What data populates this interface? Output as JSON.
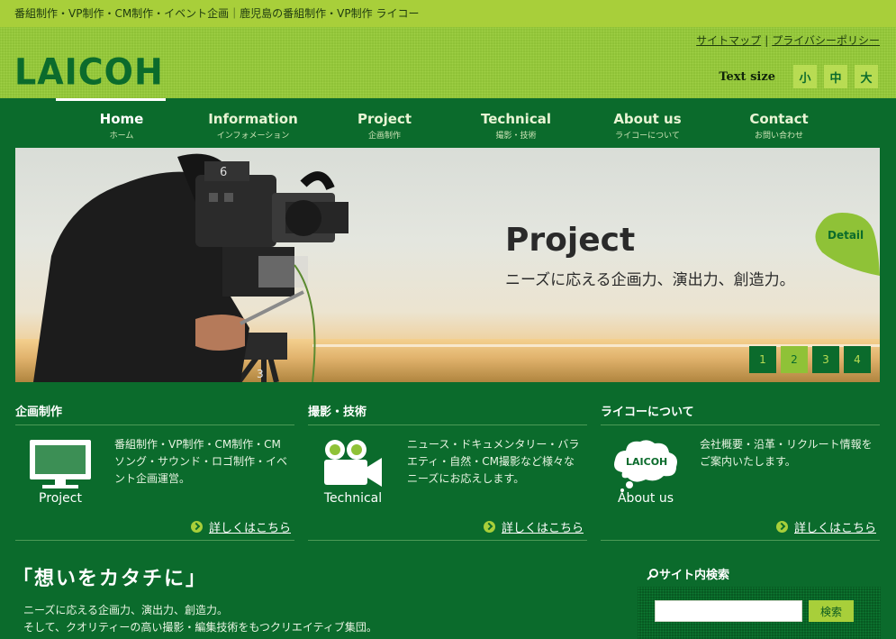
{
  "tagline": "番組制作・VP制作・CM制作・イベント企画｜鹿児島の番組制作・VP制作 ライコー",
  "header": {
    "logo": "LAICOH",
    "util_links": [
      "サイトマップ",
      "プライバシーポリシー"
    ],
    "util_separator": "|",
    "text_size_label": "Text size",
    "text_size_options": [
      "小",
      "中",
      "大"
    ]
  },
  "nav": [
    {
      "en": "Home",
      "ja": "ホーム",
      "active": true
    },
    {
      "en": "Information",
      "ja": "インフォメーション"
    },
    {
      "en": "Project",
      "ja": "企画制作"
    },
    {
      "en": "Technical",
      "ja": "撮影・技術"
    },
    {
      "en": "About us",
      "ja": "ライコーについて"
    },
    {
      "en": "Contact",
      "ja": "お問い合わせ"
    }
  ],
  "hero": {
    "title": "Project",
    "subtitle": "ニーズに応える企画力、演出力、創造力。",
    "detail": "Detail",
    "pages": [
      "1",
      "2",
      "3",
      "4"
    ],
    "current_page": "2"
  },
  "features": [
    {
      "title": "企画制作",
      "icon": "monitor-icon",
      "caption": "Project",
      "desc": "番組制作・VP制作・CM制作・CMソング・サウンド・ロゴ制作・イベント企画運営。",
      "more": "詳しくはこちら"
    },
    {
      "title": "撮影・技術",
      "icon": "video-camera-icon",
      "caption": "Technical",
      "desc": "ニュース・ドキュメンタリー・バラエティ・自然・CM撮影など様々なニーズにお応えします。",
      "more": "詳しくはこちら"
    },
    {
      "title": "ライコーについて",
      "icon": "cloud-logo-icon",
      "cloud_text": "LAICOH",
      "caption": "About us",
      "desc": "会社概要・沿革・リクルート情報をご案内いたします。",
      "more": "詳しくはこちら"
    }
  ],
  "catch": {
    "title": "「想いをカタチに」",
    "lines": [
      "ニーズに応える企画力、演出力、創造力。",
      "そして、クオリティーの高い撮影・編集技術をもつクリエイティブ集団。"
    ]
  },
  "search": {
    "title": "サイト内検索",
    "button": "検索",
    "value": ""
  },
  "colors": {
    "primary_green": "#0b6b2c",
    "lime": "#a8cf3a",
    "header_green": "#8fc237"
  }
}
